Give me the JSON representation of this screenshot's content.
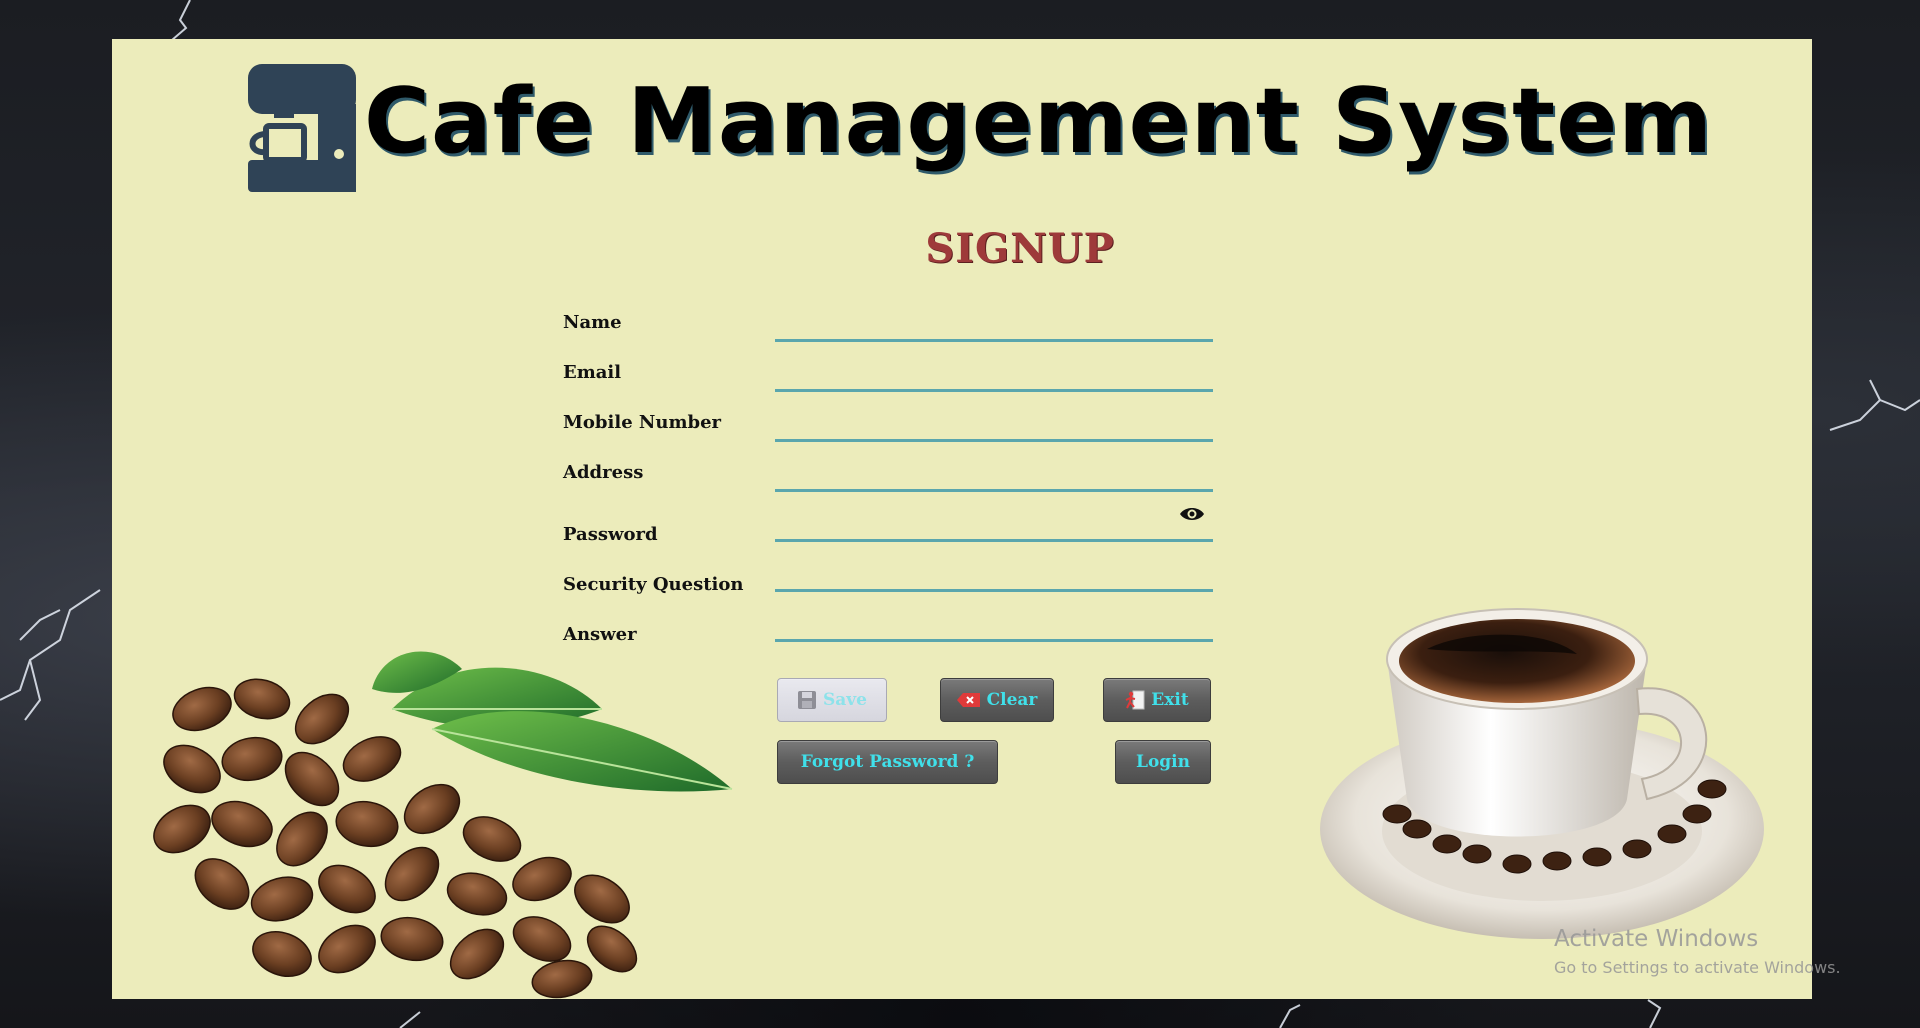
{
  "header": {
    "app_title": "Cafe Management System",
    "form_title": "SIGNUP",
    "logo_icon": "coffee-machine-icon"
  },
  "form": {
    "fields": [
      {
        "label": "Name",
        "value": ""
      },
      {
        "label": "Email",
        "value": ""
      },
      {
        "label": "Mobile Number",
        "value": ""
      },
      {
        "label": "Address",
        "value": ""
      },
      {
        "label": "Password",
        "value": ""
      },
      {
        "label": "Security Question",
        "value": ""
      },
      {
        "label": "Answer",
        "value": ""
      }
    ],
    "password_toggle_icon": "eye-icon"
  },
  "buttons": {
    "save": "Save",
    "clear": "Clear",
    "exit": "Exit",
    "forgot": "Forgot Password ?",
    "login": "Login"
  },
  "watermark": {
    "line1": "Activate Windows",
    "line2": "Go to Settings to activate Windows."
  },
  "colors": {
    "panel": "#ececbb",
    "title_red": "#9e3a3a",
    "input_underline": "#5aa6ad",
    "button_text": "#40e0ea"
  }
}
